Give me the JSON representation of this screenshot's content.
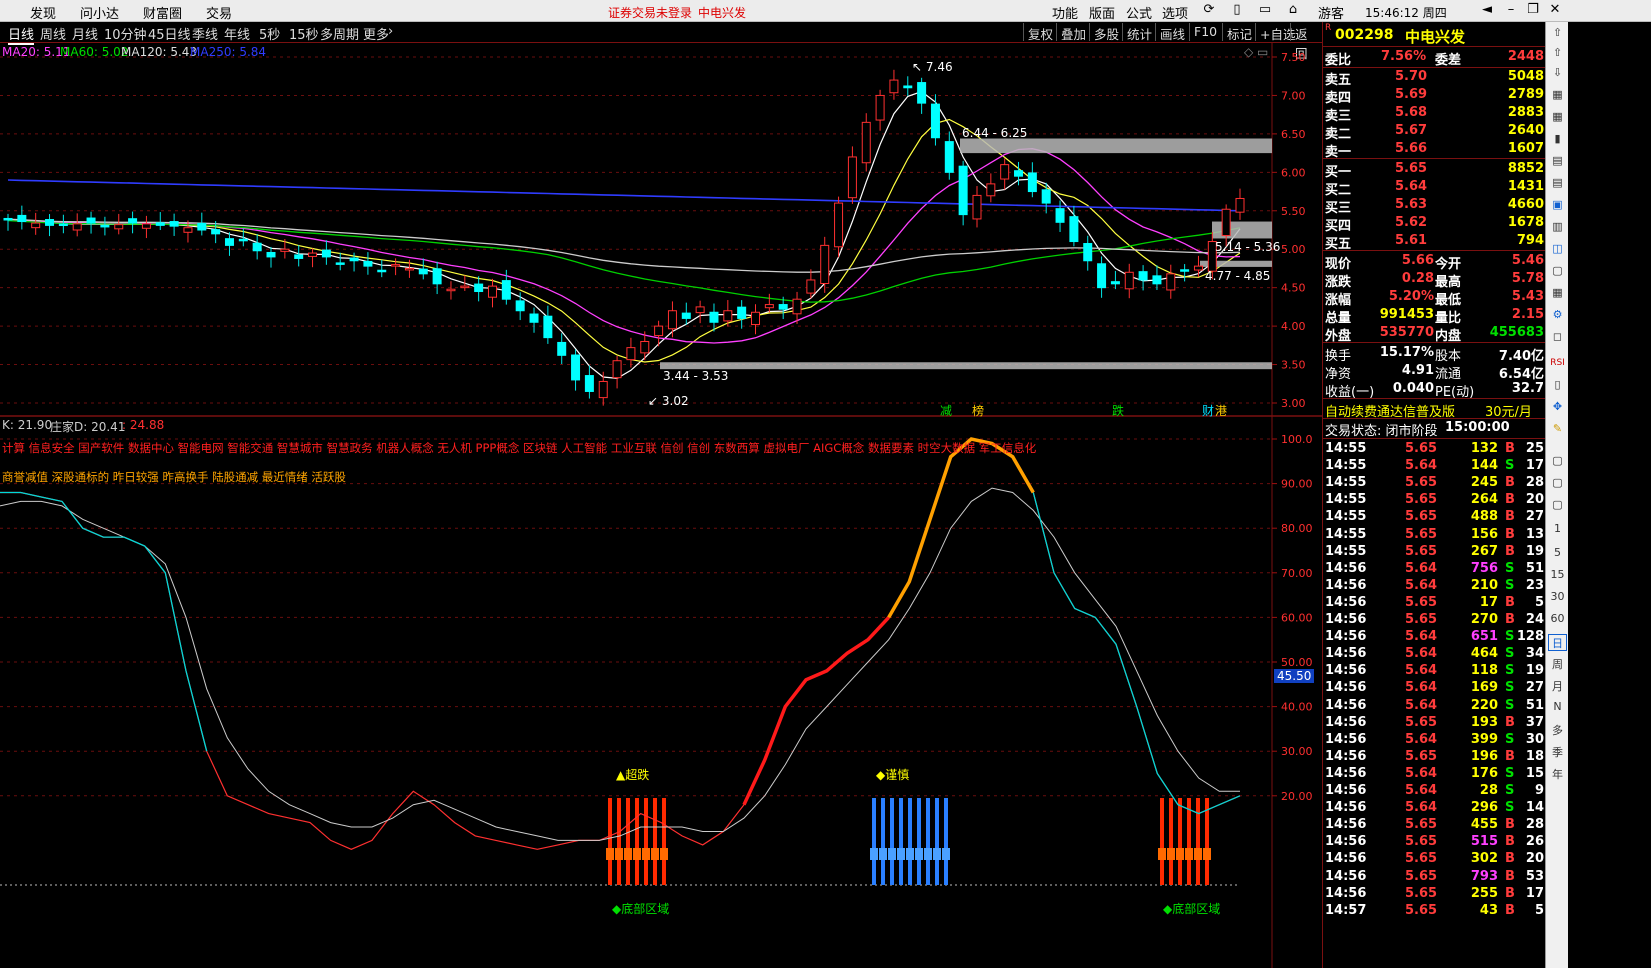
{
  "menubar": {
    "left": [
      "发现",
      "问小达",
      "财富圈",
      "交易"
    ],
    "warning": "证券交易未登录",
    "stock_short": "中电兴发",
    "right": [
      "功能",
      "版面",
      "公式",
      "选项"
    ],
    "guest": "游客",
    "clock": "15:46:12 周四"
  },
  "periods": [
    "日线",
    "周线",
    "月线",
    "10分钟",
    "45日线",
    "季线",
    "年线",
    "5秒",
    "15秒",
    "多周期",
    "更多"
  ],
  "toolbar_right": [
    "复权",
    "叠加",
    "多股",
    "统计",
    "画线",
    "F10",
    "标记",
    "+自选",
    "返回"
  ],
  "ma_legend": [
    {
      "label": "MA20: 5.11",
      "color": "#ff40ff"
    },
    {
      "label": "MA60: 5.02",
      "color": "#00e000"
    },
    {
      "label": "MA120: 5.43",
      "color": "#dddddd"
    },
    {
      "label": "MA250: 5.84",
      "color": "#2f3cff"
    }
  ],
  "price_axis": [
    "7.50",
    "7.00",
    "6.50",
    "6.00",
    "5.50",
    "5.00",
    "4.50",
    "4.00",
    "3.50",
    "3.00"
  ],
  "annotations": {
    "high": "7.46",
    "low": "3.02",
    "zone_top": "6.44 - 6.25",
    "zone_mid": "5.14 - 5.36",
    "zone_mid2": "4.77 - 4.85",
    "zone_low": "3.44 - 3.53"
  },
  "event_labels": [
    "减",
    "榜",
    "跌",
    "财",
    "港"
  ],
  "indicator": {
    "legend_k": "K: 21.90",
    "legend_d": "庄家D: 20.41",
    "legend_v": ": 24.88",
    "concepts": "计算 信息安全 国产软件 数据中心 智能电网 智能交通 智慧城市 智慧政务 机器人概念 无人机 PPP概念 区块链 人工智能 工业互联 信创 信创 东数西算 虚拟电厂 AIGC概念 数据要素 时空大数据 军工信息化",
    "concepts2": "商誉减值 深股通标的 昨日较强 昨高换手 陆股通减 最近情绪 活跃股",
    "axis": [
      "100.0",
      "90.00",
      "80.00",
      "70.00",
      "60.00",
      "50.00",
      "40.00",
      "30.00",
      "20.00"
    ],
    "current_value": "45.50",
    "signal_oversold": "▲超跌",
    "signal_caution": "◆谨慎",
    "zone_bottom_1": "◆底部区域",
    "zone_bottom_2": "◆底部区域"
  },
  "chart_data": [
    {
      "type": "candlestick",
      "title": "",
      "ylim": [
        3.0,
        7.5
      ],
      "moving_averages": {
        "MA20": 5.11,
        "MA60": 5.02,
        "MA120": 5.43,
        "MA250": 5.84
      },
      "close_path": [
        5.38,
        5.36,
        5.34,
        5.31,
        5.32,
        5.33,
        5.34,
        5.3,
        5.32,
        5.34,
        5.33,
        5.31,
        5.3,
        5.28,
        5.25,
        5.2,
        5.05,
        5.12,
        4.98,
        4.9,
        5.0,
        4.88,
        4.95,
        4.9,
        4.82,
        4.85,
        4.78,
        4.72,
        4.8,
        4.75,
        4.68,
        4.55,
        4.48,
        4.52,
        4.45,
        4.52,
        4.35,
        4.2,
        4.05,
        3.85,
        3.62,
        3.3,
        3.15,
        3.28,
        3.55,
        3.72,
        3.8,
        4.0,
        4.2,
        4.1,
        4.25,
        4.05,
        4.2,
        4.1,
        4.18,
        4.28,
        4.22,
        4.35,
        4.6,
        5.05,
        5.6,
        6.2,
        6.65,
        7.0,
        7.2,
        7.1,
        6.9,
        6.45,
        6.0,
        5.45,
        5.7,
        5.85,
        6.1,
        5.95,
        5.75,
        5.6,
        5.35,
        5.1,
        4.85,
        4.5,
        4.55,
        4.7,
        4.6,
        4.55,
        4.68,
        4.72,
        4.78,
        5.1,
        5.52,
        5.66
      ],
      "levels": {
        "high": 7.46,
        "low": 3.02
      }
    },
    {
      "type": "line",
      "title": "",
      "ylim": [
        0,
        105
      ],
      "series": [
        {
          "name": "K",
          "color": "#ff3030",
          "values": [
            88,
            88,
            87,
            86,
            80,
            78,
            78,
            76,
            70,
            48,
            30,
            20,
            18,
            16,
            15,
            14,
            10,
            8,
            10,
            16,
            21,
            18,
            14,
            11,
            10,
            9,
            8,
            9,
            10,
            10,
            12,
            16,
            14,
            11,
            9,
            12,
            18,
            28,
            40,
            46,
            48,
            52,
            55,
            60,
            68,
            82,
            96,
            100,
            99,
            96,
            88,
            70,
            62,
            60,
            54,
            40,
            25,
            18,
            16,
            18,
            20
          ]
        },
        {
          "name": "D",
          "color": "#cccccc",
          "values": [
            85,
            86,
            86,
            85,
            82,
            80,
            78,
            76,
            72,
            60,
            44,
            33,
            26,
            21,
            18,
            16,
            14,
            13,
            13,
            15,
            18,
            19,
            17,
            15,
            13,
            12,
            11,
            10,
            10,
            10,
            11,
            13,
            13,
            13,
            12,
            12,
            15,
            20,
            27,
            35,
            40,
            45,
            50,
            55,
            62,
            70,
            80,
            86,
            89,
            88,
            84,
            78,
            70,
            64,
            58,
            48,
            38,
            30,
            24,
            21,
            21
          ]
        }
      ]
    }
  ],
  "quote": {
    "code": "002298",
    "name": "中电兴发",
    "weibi_label": "委比",
    "weibi": "7.56%",
    "weicha_label": "委差",
    "weicha": "2448",
    "asks": [
      {
        "label": "卖五",
        "price": "5.70",
        "vol": "5048"
      },
      {
        "label": "卖四",
        "price": "5.69",
        "vol": "2789"
      },
      {
        "label": "卖三",
        "price": "5.68",
        "vol": "2883"
      },
      {
        "label": "卖二",
        "price": "5.67",
        "vol": "2640"
      },
      {
        "label": "卖一",
        "price": "5.66",
        "vol": "1607"
      }
    ],
    "bids": [
      {
        "label": "买一",
        "price": "5.65",
        "vol": "8852"
      },
      {
        "label": "买二",
        "price": "5.64",
        "vol": "1431"
      },
      {
        "label": "买三",
        "price": "5.63",
        "vol": "4660"
      },
      {
        "label": "买四",
        "price": "5.62",
        "vol": "1678"
      },
      {
        "label": "买五",
        "price": "5.61",
        "vol": "794"
      }
    ],
    "stats": [
      {
        "l1": "现价",
        "v1": "5.66",
        "c1": "red",
        "l2": "今开",
        "v2": "5.46",
        "c2": "red"
      },
      {
        "l1": "涨跌",
        "v1": "0.28",
        "c1": "red",
        "l2": "最高",
        "v2": "5.78",
        "c2": "red"
      },
      {
        "l1": "涨幅",
        "v1": "5.20%",
        "c1": "red",
        "l2": "最低",
        "v2": "5.43",
        "c2": "red"
      },
      {
        "l1": "总量",
        "v1": "991453",
        "c1": "yel",
        "l2": "量比",
        "v2": "2.15",
        "c2": "red"
      },
      {
        "l1": "外盘",
        "v1": "535770",
        "c1": "red",
        "l2": "内盘",
        "v2": "455683",
        "c2": "green"
      }
    ],
    "stats2": [
      {
        "l1": "换手",
        "v1": "15.17%",
        "l2": "股本",
        "v2": "7.40亿"
      },
      {
        "l1": "净资",
        "v1": "4.91",
        "l2": "流通",
        "v2": "6.54亿"
      },
      {
        "l1": "收益(一)",
        "v1": "0.040",
        "l2": "PE(动)",
        "v2": "32.7"
      }
    ],
    "promo": "自动续费通达信普及版",
    "promo_price": "30元/月",
    "status_label": "交易状态: 闭市阶段",
    "status_time": "15:00:00"
  },
  "ticks": [
    {
      "t": "14:55",
      "p": "5.65",
      "v": "132",
      "bs": "B",
      "n": "25"
    },
    {
      "t": "14:55",
      "p": "5.64",
      "v": "144",
      "bs": "S",
      "n": "17"
    },
    {
      "t": "14:55",
      "p": "5.65",
      "v": "245",
      "bs": "B",
      "n": "28"
    },
    {
      "t": "14:55",
      "p": "5.65",
      "v": "264",
      "bs": "B",
      "n": "20"
    },
    {
      "t": "14:55",
      "p": "5.65",
      "v": "488",
      "bs": "B",
      "n": "27"
    },
    {
      "t": "14:55",
      "p": "5.65",
      "v": "156",
      "bs": "B",
      "n": "13"
    },
    {
      "t": "14:55",
      "p": "5.65",
      "v": "267",
      "bs": "B",
      "n": "19"
    },
    {
      "t": "14:56",
      "p": "5.64",
      "v": "756",
      "bs": "S",
      "n": "51"
    },
    {
      "t": "14:56",
      "p": "5.64",
      "v": "210",
      "bs": "S",
      "n": "23"
    },
    {
      "t": "14:56",
      "p": "5.65",
      "v": "17",
      "bs": "B",
      "n": "5"
    },
    {
      "t": "14:56",
      "p": "5.65",
      "v": "270",
      "bs": "B",
      "n": "24"
    },
    {
      "t": "14:56",
      "p": "5.64",
      "v": "651",
      "bs": "S",
      "n": "128"
    },
    {
      "t": "14:56",
      "p": "5.64",
      "v": "464",
      "bs": "S",
      "n": "34"
    },
    {
      "t": "14:56",
      "p": "5.64",
      "v": "118",
      "bs": "S",
      "n": "19"
    },
    {
      "t": "14:56",
      "p": "5.64",
      "v": "169",
      "bs": "S",
      "n": "27"
    },
    {
      "t": "14:56",
      "p": "5.64",
      "v": "220",
      "bs": "S",
      "n": "51"
    },
    {
      "t": "14:56",
      "p": "5.65",
      "v": "193",
      "bs": "B",
      "n": "37"
    },
    {
      "t": "14:56",
      "p": "5.64",
      "v": "399",
      "bs": "S",
      "n": "30"
    },
    {
      "t": "14:56",
      "p": "5.65",
      "v": "196",
      "bs": "B",
      "n": "18"
    },
    {
      "t": "14:56",
      "p": "5.64",
      "v": "176",
      "bs": "S",
      "n": "15"
    },
    {
      "t": "14:56",
      "p": "5.64",
      "v": "28",
      "bs": "S",
      "n": "9"
    },
    {
      "t": "14:56",
      "p": "5.64",
      "v": "296",
      "bs": "S",
      "n": "14"
    },
    {
      "t": "14:56",
      "p": "5.65",
      "v": "455",
      "bs": "B",
      "n": "28"
    },
    {
      "t": "14:56",
      "p": "5.65",
      "v": "515",
      "bs": "B",
      "n": "26"
    },
    {
      "t": "14:56",
      "p": "5.65",
      "v": "302",
      "bs": "B",
      "n": "20"
    },
    {
      "t": "14:56",
      "p": "5.65",
      "v": "793",
      "bs": "B",
      "n": "53"
    },
    {
      "t": "14:56",
      "p": "5.65",
      "v": "255",
      "bs": "B",
      "n": "17"
    },
    {
      "t": "14:57",
      "p": "5.65",
      "v": "43",
      "bs": "B",
      "n": "5"
    }
  ],
  "tools_right": [
    "周",
    "月",
    "N",
    "多",
    "季",
    "年"
  ]
}
